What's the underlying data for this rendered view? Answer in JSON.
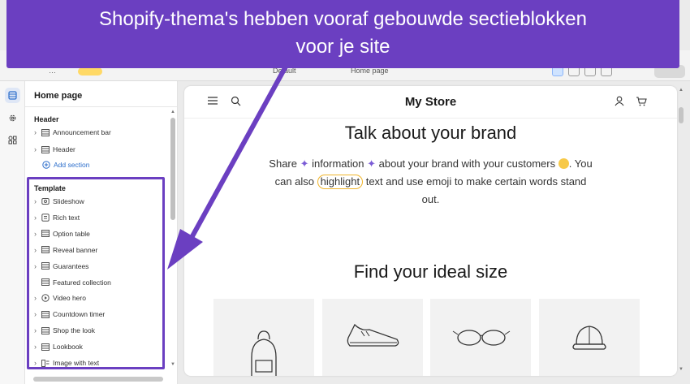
{
  "banner": {
    "text_line1": "Shopify-thema's hebben vooraf gebouwde sectieblokken",
    "text_line2": "voor je site"
  },
  "topbar": {
    "crumb_left": "…",
    "crumb_mid": "Default",
    "crumb_right": "Home page"
  },
  "rail": {
    "items": [
      {
        "icon": "sections-icon",
        "active": true
      },
      {
        "icon": "gear-icon",
        "active": false
      },
      {
        "icon": "apps-icon",
        "active": false
      }
    ]
  },
  "panel": {
    "title": "Home page",
    "header_group": "Header",
    "header_items": [
      "Announcement bar",
      "Header"
    ],
    "add_section": "Add section",
    "template_group": "Template",
    "template_items": [
      {
        "label": "Slideshow",
        "icon": "slideshow-icon",
        "chevron": true
      },
      {
        "label": "Rich text",
        "icon": "text-block-icon",
        "chevron": true
      },
      {
        "label": "Option table",
        "icon": "table-icon",
        "chevron": true
      },
      {
        "label": "Reveal banner",
        "icon": "table-icon",
        "chevron": true
      },
      {
        "label": "Guarantees",
        "icon": "table-icon",
        "chevron": true
      },
      {
        "label": "Featured collection",
        "icon": "table-icon",
        "chevron": false
      },
      {
        "label": "Video hero",
        "icon": "play-icon",
        "chevron": true
      },
      {
        "label": "Countdown timer",
        "icon": "table-icon",
        "chevron": true
      },
      {
        "label": "Shop the look",
        "icon": "table-icon",
        "chevron": true
      },
      {
        "label": "Lookbook",
        "icon": "table-icon",
        "chevron": true
      },
      {
        "label": "Image with text",
        "icon": "image-text-icon",
        "chevron": true
      }
    ]
  },
  "preview": {
    "store_name": "My Store",
    "brand_title": "Talk about your brand",
    "brand_text_1": "Share",
    "brand_text_2": "information",
    "brand_text_3": "about your brand with your customers",
    "brand_text_4": ". You can also",
    "brand_highlight": "highlight",
    "brand_text_5": "text and  use emoji  to make certain words stand out.",
    "size_title": "Find your ideal size",
    "cards": [
      "backpack-icon",
      "sneaker-icon",
      "glasses-icon",
      "cap-icon"
    ]
  },
  "colors": {
    "accent_purple": "#6b3fc1",
    "highlight_outline": "#f0b429",
    "link_blue": "#2c6ecb"
  }
}
